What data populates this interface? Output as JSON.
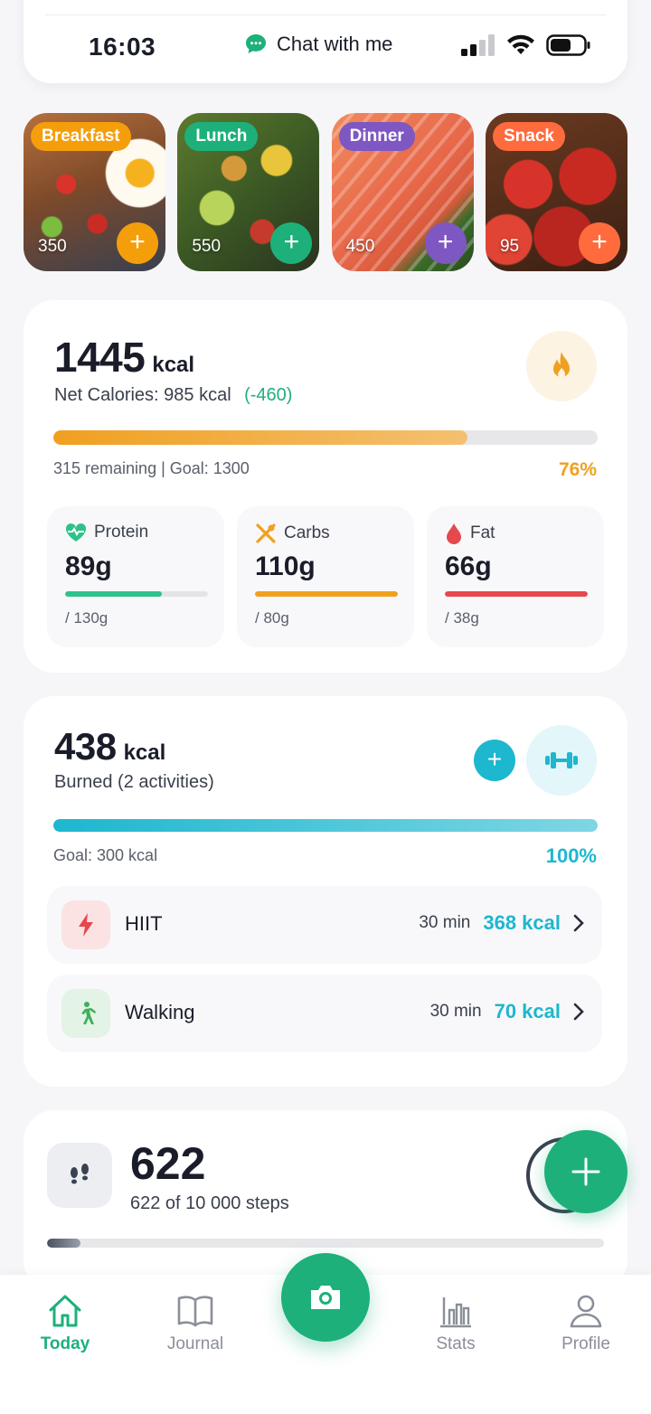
{
  "status_bar": {
    "time": "16:03",
    "chat_label": "Chat with me"
  },
  "meals": [
    {
      "label": "Breakfast",
      "kcal": "350",
      "tag_color": "#f59e0b"
    },
    {
      "label": "Lunch",
      "kcal": "550",
      "tag_color": "#1db07a"
    },
    {
      "label": "Dinner",
      "kcal": "450",
      "tag_color": "#7e57c2"
    },
    {
      "label": "Snack",
      "kcal": "95",
      "tag_color": "#ff6b3d"
    }
  ],
  "calories": {
    "total": "1445",
    "unit": "kcal",
    "net_label": "Net Calories: 985 kcal",
    "net_diff": "(-460)",
    "remaining_text": "315 remaining | Goal: 1300",
    "percent_text": "76%",
    "progress": 0.76
  },
  "macros": [
    {
      "name": "Protein",
      "value": "89g",
      "goal": "/ 130g",
      "progress": 0.68,
      "color": "#2ec28a",
      "icon": "heart-pulse-icon"
    },
    {
      "name": "Carbs",
      "value": "110g",
      "goal": "/ 80g",
      "progress": 1.0,
      "color": "#f0a020",
      "icon": "utensils-icon"
    },
    {
      "name": "Fat",
      "value": "66g",
      "goal": "/ 38g",
      "progress": 1.0,
      "color": "#e5484d",
      "icon": "drop-icon"
    }
  ],
  "burned": {
    "total": "438",
    "unit": "kcal",
    "label": "Burned (2 activities)",
    "goal_text": "Goal: 300 kcal",
    "percent_text": "100%",
    "progress": 1.0
  },
  "activities": [
    {
      "name": "HIIT",
      "duration": "30 min",
      "kcal": "368 kcal",
      "icon": "lightning-icon"
    },
    {
      "name": "Walking",
      "duration": "30 min",
      "kcal": "70 kcal",
      "icon": "walking-icon"
    }
  ],
  "steps": {
    "count": "622",
    "detail": "622 of 10 000 steps",
    "progress": 0.06
  },
  "nav": {
    "today": "Today",
    "journal": "Journal",
    "stats": "Stats",
    "profile": "Profile"
  },
  "colors": {
    "accent_green": "#1db07a",
    "accent_orange": "#f0a020",
    "accent_cyan": "#1db7cf"
  }
}
